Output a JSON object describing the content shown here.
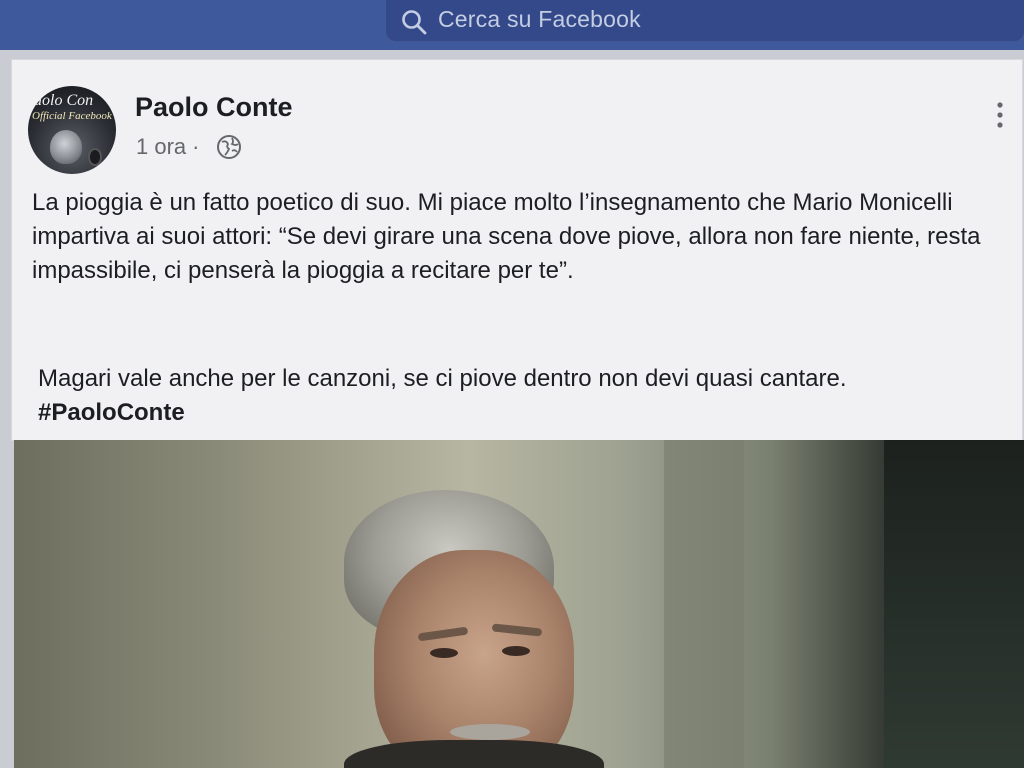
{
  "topbar": {
    "search_placeholder": "Cerca su Facebook",
    "search_icon": "search-icon",
    "colors": {
      "bar": "#3f5a9c",
      "search_box": "#34498a"
    }
  },
  "post": {
    "author": "Paolo Conte",
    "avatar": {
      "line1": "aolo Con",
      "line2": "Official Facebook"
    },
    "time": "1 ora",
    "separator": "·",
    "audience_icon": "globe-icon",
    "more_icon": "more-options-icon",
    "text_para1": "La pioggia è un fatto poetico di suo. Mi piace molto l’insegnamento che Mario Monicelli impartiva ai suoi attori: “Se devi girare una scena dove piove, allora non fare niente, resta impassibile, ci penserà la pioggia a recitare per te”.",
    "text_para2": "Magari vale anche per le canzoni, se ci piove dentro non devi quasi cantare.",
    "hashtag": "#PaoloConte"
  }
}
